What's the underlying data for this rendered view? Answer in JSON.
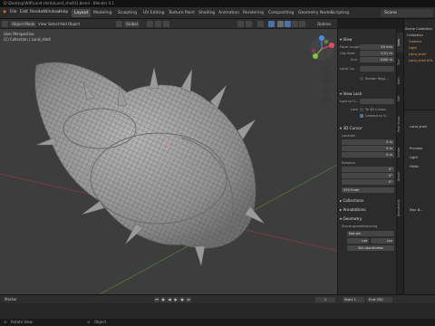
{
  "app": {
    "title_bar": "D:\\Desktop\\WIP\\Land shells\\Land_shell01.blend - Blender 4.1",
    "menu": [
      "File",
      "Edit",
      "Render",
      "Window",
      "Help"
    ]
  },
  "workspaces": [
    "Layout",
    "Modeling",
    "Sculpting",
    "UV Editing",
    "Texture Paint",
    "Shading",
    "Animation",
    "Rendering",
    "Compositing",
    "Geometry Nodes",
    "Scripting"
  ],
  "active_workspace": "Layout",
  "scene": {
    "scene_name": "Scene",
    "view_layer": "ViewLayer"
  },
  "viewport_header": {
    "mode": "Object Mode",
    "menus": [
      "View",
      "Select",
      "Add",
      "Object"
    ],
    "transform_orientation": "Global",
    "options_label": "Options"
  },
  "viewport_overlay": {
    "info_line1": "User Perspective",
    "info_line2": "(1) Collection | Land_shell"
  },
  "npanel": {
    "view_section": "View",
    "focal_length_label": "Focal Length",
    "focal_length": "50 mm",
    "clip_start_label": "Clip Start",
    "clip_start": "0.01 m",
    "clip_end_label": "End",
    "clip_end": "1000 m",
    "local_camera_label": "Local Ca...",
    "render_region_label": "Render Regi...",
    "view_lock_section": "View Lock",
    "lock_to_object_label": "Lock to O...",
    "lock_label": "Lock",
    "to_3d_cursor": "To 3D Cursor",
    "camera_to_view": "Camera to V...",
    "cursor_section": "3D Cursor",
    "location_label": "Location",
    "loc_x_label": "X",
    "loc_x": "0 m",
    "loc_y_label": "Y",
    "loc_y": "0 m",
    "loc_z_label": "Z",
    "loc_z": "0 m",
    "rotation_label": "Rotation",
    "rot_x_label": "X",
    "rot_x": "0°",
    "rot_y_label": "Y",
    "rot_y": "0°",
    "rot_z_label": "Z",
    "rot_z": "0°",
    "rotation_mode": "XYZ Euler",
    "collections_section": "Collections",
    "annotations_section": "Annotations",
    "geometry_section": "Geometry",
    "georef_label": "Scene georeferencing",
    "not_set": "Not set",
    "georef_x": "Lat",
    "georef_y": "Lon",
    "set_coordinates": "Set coordinates"
  },
  "npanel_tabs": [
    "View",
    "Tool",
    "Item",
    "Edit",
    "Real Snow",
    "Create",
    "Blosm",
    "BlenderGIS"
  ],
  "active_npanel_tab": "View",
  "outliner": {
    "rows": [
      "Scene Collection",
      "Collection",
      "Camera",
      "Light",
      "Land_shell",
      "Land_shell.001"
    ]
  },
  "properties": {
    "rows": [
      "Land_shell",
      "Preview",
      "Light",
      "Fields"
    ],
    "section_main": "Max B..."
  },
  "timeline": {
    "menus": [
      "Playback",
      "Keying",
      "View",
      "Marker"
    ],
    "marker_label": "Marker",
    "current_frame": "1",
    "start_label": "Start",
    "start": "1",
    "end_label": "End",
    "end": "250"
  },
  "statusbar": {
    "left_hint": "Rotate View",
    "right_hint": "Object"
  },
  "colors": {
    "accent": "#4772b3",
    "gizmo_x": "#e44d5e",
    "gizmo_y": "#7ac943",
    "gizmo_z": "#4d8bea",
    "viewport_bg": "#3d3d3d"
  }
}
